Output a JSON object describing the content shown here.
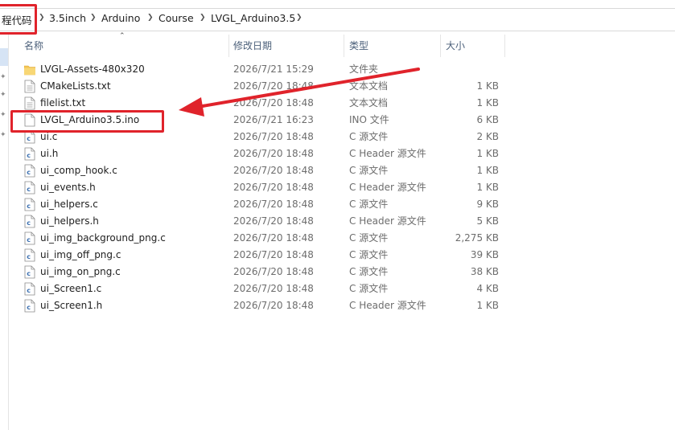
{
  "breadcrumb": {
    "items": [
      "程代码",
      "3.5inch",
      "Arduino",
      "Course",
      "LVGL_Arduino3.5"
    ],
    "dropdown_icon": "chevron-down-icon"
  },
  "columns": {
    "name": "名称",
    "date": "修改日期",
    "type": "类型",
    "size": "大小"
  },
  "files": [
    {
      "name": "LVGL-Assets-480x320",
      "date": "2026/7/21 15:29",
      "type": "文件夹",
      "size": "",
      "icon": "folder-icon"
    },
    {
      "name": "CMakeLists.txt",
      "date": "2026/7/20 18:48",
      "type": "文本文档",
      "size": "1 KB",
      "icon": "text-file-icon"
    },
    {
      "name": "filelist.txt",
      "date": "2026/7/20 18:48",
      "type": "文本文档",
      "size": "1 KB",
      "icon": "text-file-icon"
    },
    {
      "name": "LVGL_Arduino3.5.ino",
      "date": "2026/7/21 16:23",
      "type": "INO 文件",
      "size": "6 KB",
      "icon": "blank-file-icon"
    },
    {
      "name": "ui.c",
      "date": "2026/7/20 18:48",
      "type": "C 源文件",
      "size": "2 KB",
      "icon": "c-file-icon"
    },
    {
      "name": "ui.h",
      "date": "2026/7/20 18:48",
      "type": "C Header 源文件",
      "size": "1 KB",
      "icon": "c-file-icon"
    },
    {
      "name": "ui_comp_hook.c",
      "date": "2026/7/20 18:48",
      "type": "C 源文件",
      "size": "1 KB",
      "icon": "c-file-icon"
    },
    {
      "name": "ui_events.h",
      "date": "2026/7/20 18:48",
      "type": "C Header 源文件",
      "size": "1 KB",
      "icon": "c-file-icon"
    },
    {
      "name": "ui_helpers.c",
      "date": "2026/7/20 18:48",
      "type": "C 源文件",
      "size": "9 KB",
      "icon": "c-file-icon"
    },
    {
      "name": "ui_helpers.h",
      "date": "2026/7/20 18:48",
      "type": "C Header 源文件",
      "size": "5 KB",
      "icon": "c-file-icon"
    },
    {
      "name": "ui_img_background_png.c",
      "date": "2026/7/20 18:48",
      "type": "C 源文件",
      "size": "2,275 KB",
      "icon": "c-file-icon"
    },
    {
      "name": "ui_img_off_png.c",
      "date": "2026/7/20 18:48",
      "type": "C 源文件",
      "size": "39 KB",
      "icon": "c-file-icon"
    },
    {
      "name": "ui_img_on_png.c",
      "date": "2026/7/20 18:48",
      "type": "C 源文件",
      "size": "38 KB",
      "icon": "c-file-icon"
    },
    {
      "name": "ui_Screen1.c",
      "date": "2026/7/20 18:48",
      "type": "C 源文件",
      "size": "4 KB",
      "icon": "c-file-icon"
    },
    {
      "name": "ui_Screen1.h",
      "date": "2026/7/20 18:48",
      "type": "C Header 源文件",
      "size": "1 KB",
      "icon": "c-file-icon"
    }
  ],
  "highlight_color": "#e0232b"
}
